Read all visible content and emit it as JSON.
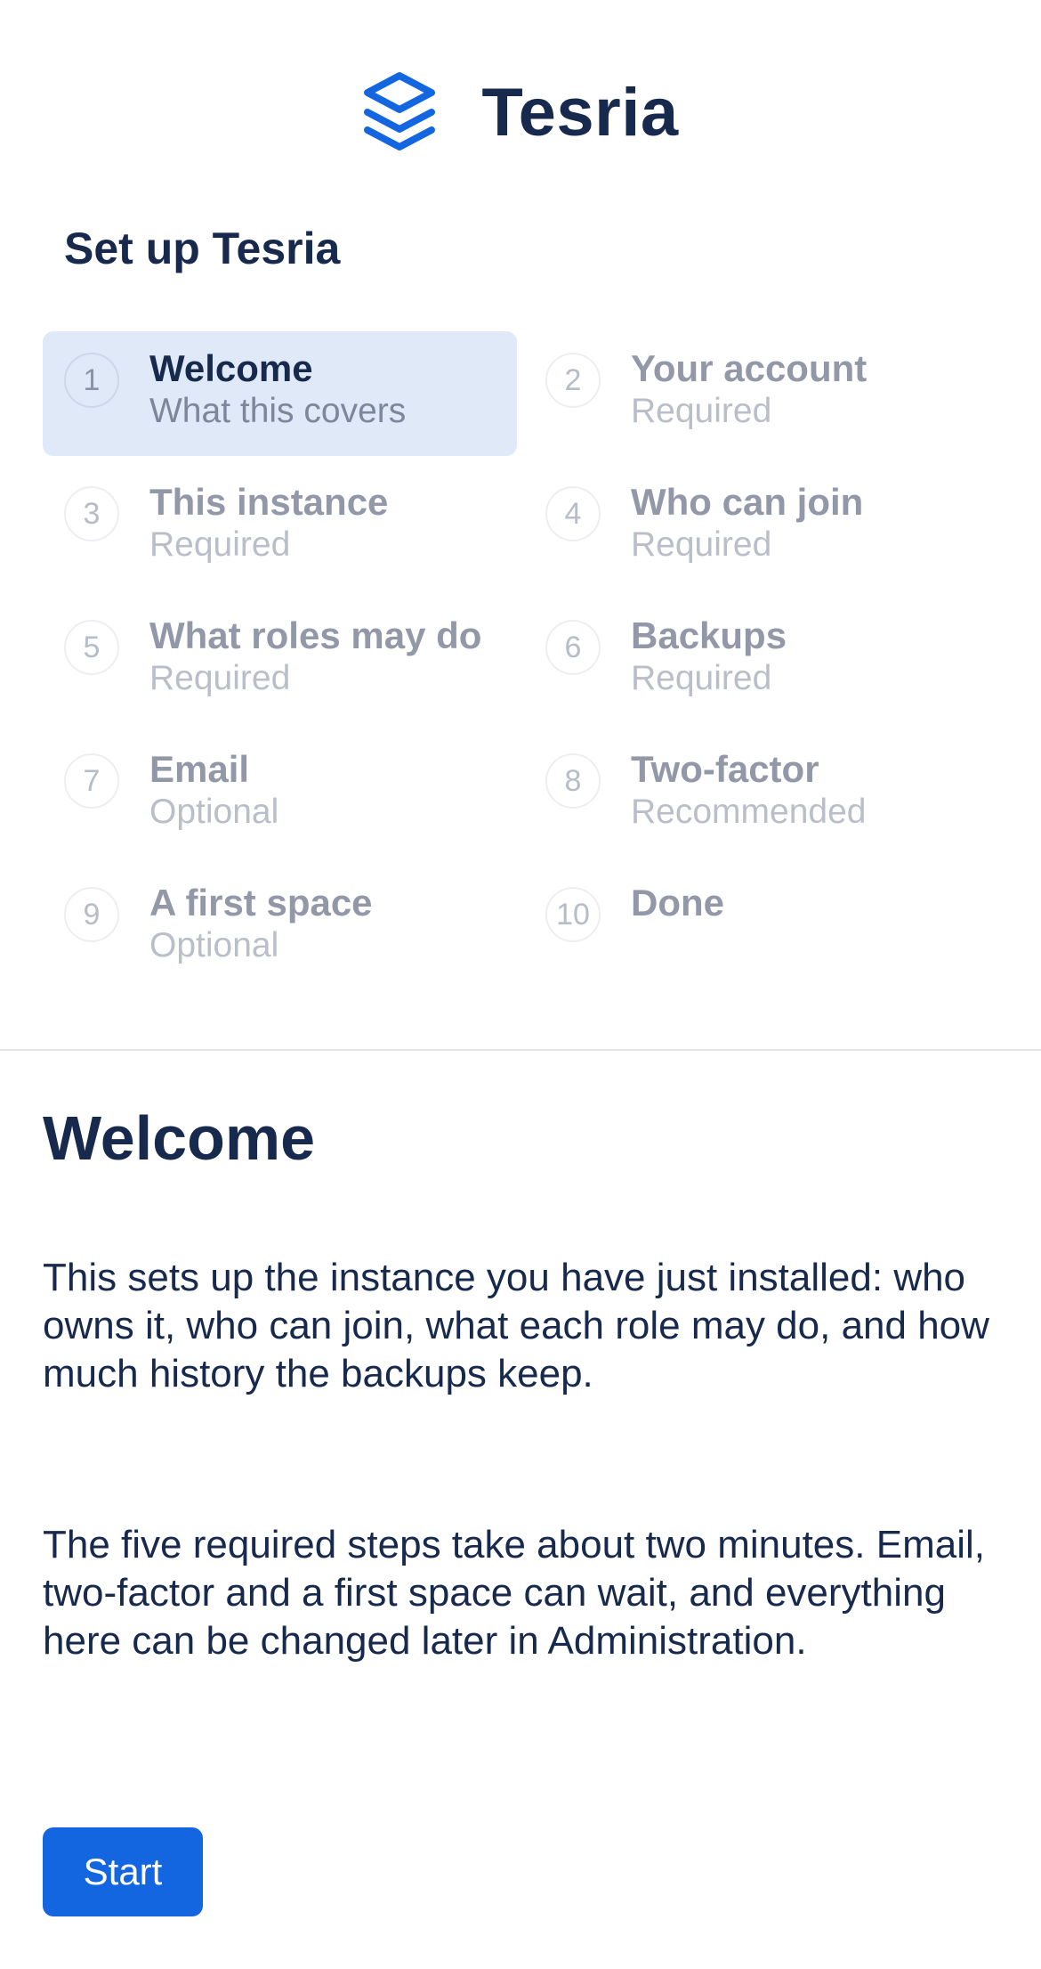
{
  "header": {
    "logo_icon": "stacked-layers-icon",
    "brand": "Tesria",
    "accent_color": "#1366e0"
  },
  "setup": {
    "title": "Set up Tesria",
    "steps": [
      {
        "number": "1",
        "title": "Welcome",
        "subtitle": "What this covers",
        "active": true
      },
      {
        "number": "2",
        "title": "Your account",
        "subtitle": "Required",
        "active": false
      },
      {
        "number": "3",
        "title": "This instance",
        "subtitle": "Required",
        "active": false
      },
      {
        "number": "4",
        "title": "Who can join",
        "subtitle": "Required",
        "active": false
      },
      {
        "number": "5",
        "title": "What roles may do",
        "subtitle": "Required",
        "active": false
      },
      {
        "number": "6",
        "title": "Backups",
        "subtitle": "Required",
        "active": false
      },
      {
        "number": "7",
        "title": "Email",
        "subtitle": "Optional",
        "active": false
      },
      {
        "number": "8",
        "title": "Two-factor",
        "subtitle": "Recommended",
        "active": false
      },
      {
        "number": "9",
        "title": "A first space",
        "subtitle": "Optional",
        "active": false
      },
      {
        "number": "10",
        "title": "Done",
        "subtitle": "",
        "active": false
      }
    ]
  },
  "content": {
    "title": "Welcome",
    "paragraph_1": "This sets up the instance you have just installed: who owns it, who can join, what each role may do, and how much history the backups keep.",
    "paragraph_2": "The five required steps take about two minutes. Email, two-factor and a first space can wait, and everything here can be changed later in Administration.",
    "start_label": "Start"
  }
}
